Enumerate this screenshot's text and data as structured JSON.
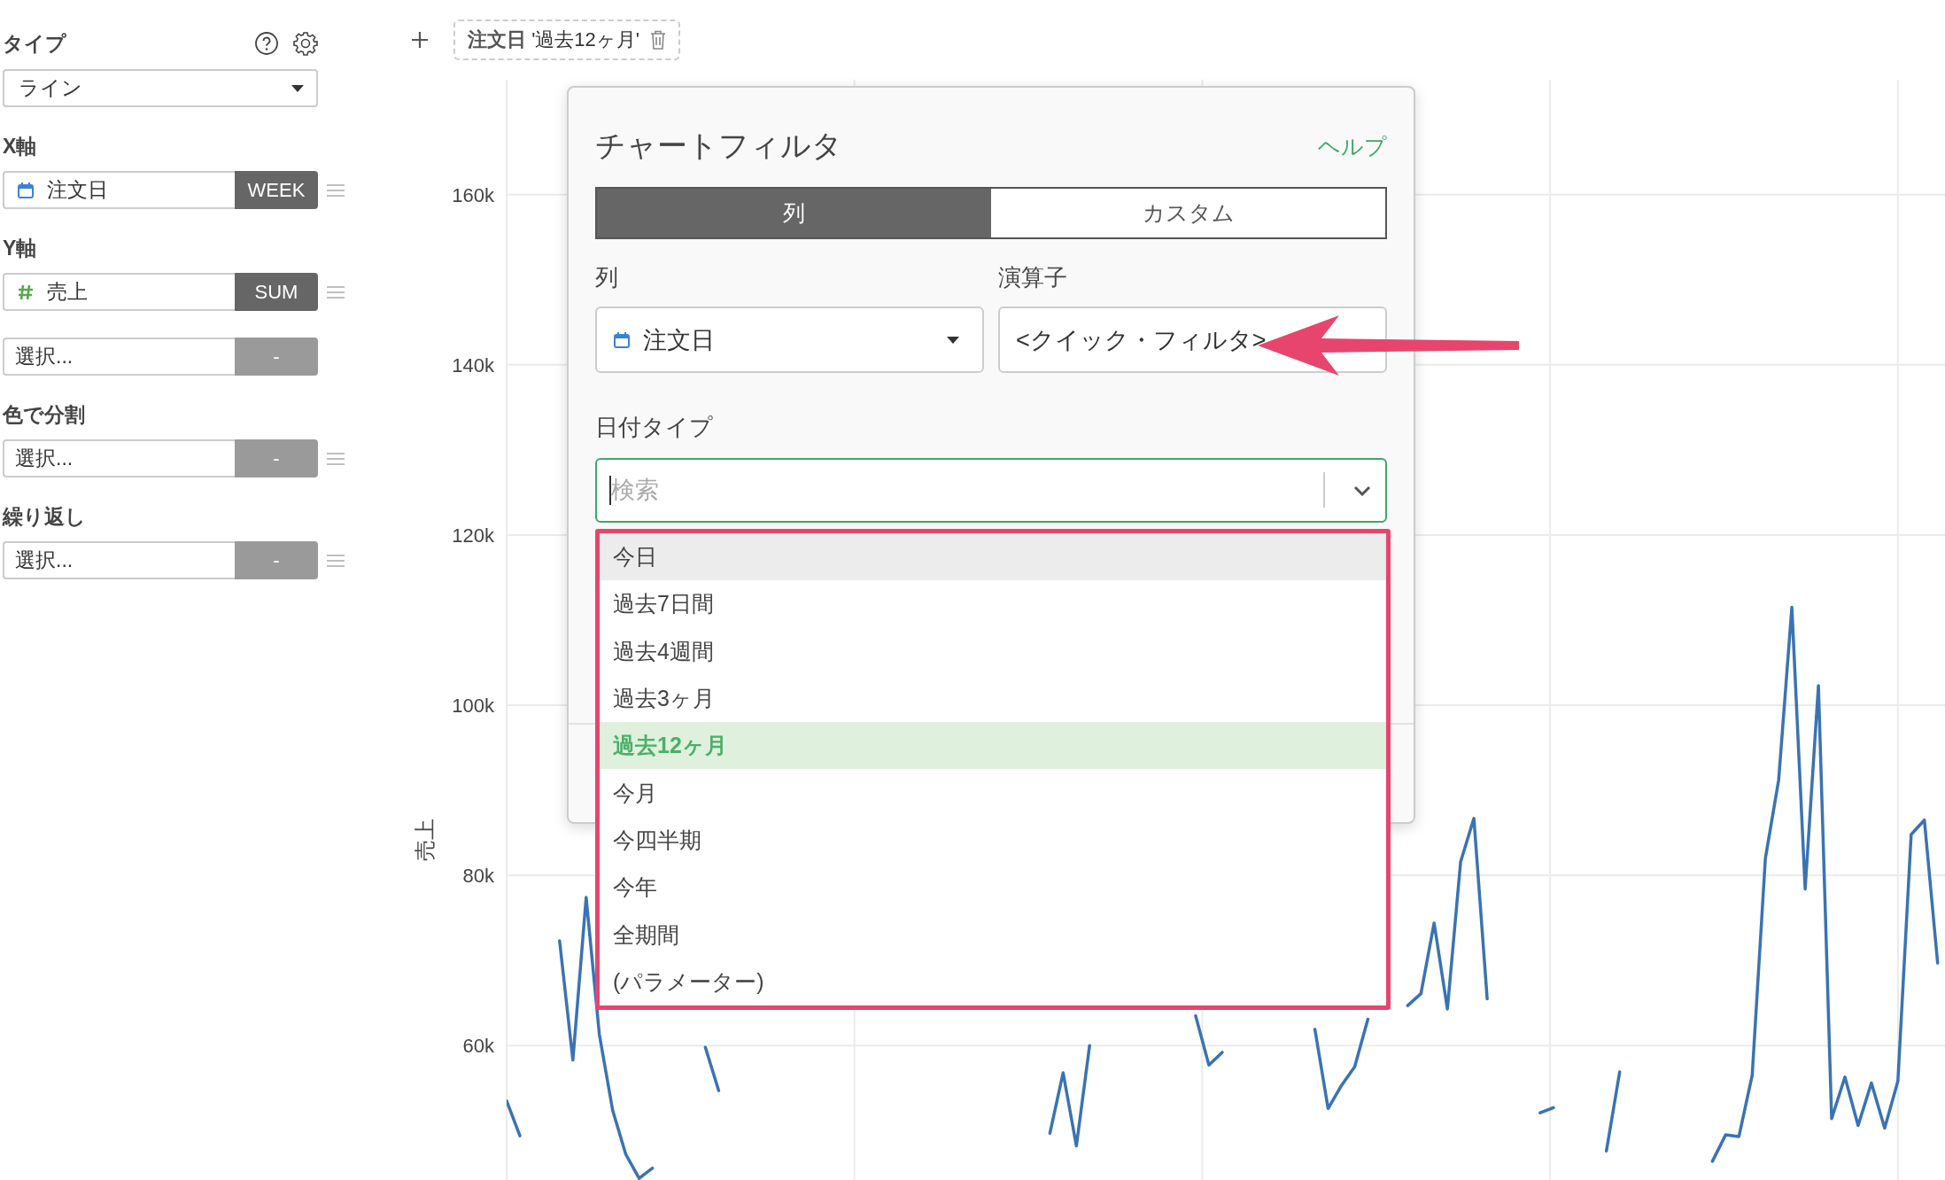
{
  "sidebar": {
    "title": "タイプ",
    "chart_type": "ライン",
    "sections": [
      {
        "label": "X軸",
        "rows": [
          {
            "kind": "date",
            "field": "注文日",
            "tag": "WEEK",
            "handle": true
          }
        ]
      },
      {
        "label": "Y軸",
        "rows": [
          {
            "kind": "number",
            "field": "売上",
            "tag": "SUM",
            "handle": true
          },
          {
            "kind": "empty",
            "field": "選択...",
            "tag": "-",
            "handle": false
          }
        ]
      },
      {
        "label": "色で分割",
        "rows": [
          {
            "kind": "empty",
            "field": "選択...",
            "tag": "-",
            "handle": true
          }
        ]
      },
      {
        "label": "繰り返し",
        "rows": [
          {
            "kind": "empty",
            "field": "選択...",
            "tag": "-",
            "handle": true
          }
        ]
      }
    ]
  },
  "filter_bar": {
    "filters": [
      {
        "column": "注文日",
        "value": "'過去12ヶ月'"
      }
    ]
  },
  "chart": {
    "chart_data": {
      "type": "line",
      "ylabel": "売上",
      "grid": true,
      "ylim": [
        44.2,
        173.5
      ],
      "yticks": [
        {
          "value": 60,
          "label": "60k"
        },
        {
          "value": 80,
          "label": "80k"
        },
        {
          "value": 100,
          "label": "100k"
        },
        {
          "value": 120,
          "label": "120k"
        },
        {
          "value": 140,
          "label": "140k"
        },
        {
          "value": 160,
          "label": "160k"
        }
      ],
      "series": [
        {
          "color": "#3a73b3",
          "values": [
            53.5,
            49.4,
            null,
            null,
            72.3,
            58.3,
            77.4,
            61.3,
            52.4,
            47.2,
            44.4,
            45.6,
            null,
            null,
            null,
            59.8,
            54.7,
            null,
            null,
            null,
            null,
            null,
            null,
            null,
            null,
            null,
            null,
            null,
            null,
            null,
            null,
            null,
            null,
            null,
            null,
            null,
            null,
            null,
            null,
            null,
            null,
            49.7,
            56.8,
            48.2,
            60,
            null,
            null,
            null,
            null,
            null,
            null,
            null,
            63.5,
            57.7,
            59.2,
            null,
            null,
            null,
            null,
            null,
            null,
            61.9,
            52.6,
            55.3,
            57.5,
            63.1,
            null,
            null,
            64.7,
            66.1,
            74.4,
            64.3,
            81.6,
            86.7,
            65.5,
            null,
            null,
            null,
            52.1,
            52.7,
            null,
            null,
            null,
            47.6,
            56.9,
            null,
            null,
            null,
            null,
            null,
            null,
            46.4,
            49.5,
            49.3,
            56.5,
            82,
            91.2,
            111.5,
            78.4,
            102.3,
            51.4,
            56.3,
            50.6,
            55.6,
            50.3,
            55.8,
            84.8,
            86.5,
            69.7
          ]
        }
      ]
    }
  },
  "dialog": {
    "title": "チャートフィルタ",
    "help": "ヘルプ",
    "tabs": [
      {
        "label": "列",
        "selected": true
      },
      {
        "label": "カスタム",
        "selected": false
      }
    ],
    "column_label": "列",
    "column_value": "注文日",
    "operator_label": "演算子",
    "operator_value": "<クイック・フィルタ>",
    "date_type_label": "日付タイプ",
    "search": {
      "placeholder": "検索"
    },
    "options": [
      {
        "label": "今日",
        "selected": false,
        "hovered": true
      },
      {
        "label": "過去7日間",
        "selected": false,
        "hovered": false
      },
      {
        "label": "過去4週間",
        "selected": false,
        "hovered": false
      },
      {
        "label": "過去3ヶ月",
        "selected": false,
        "hovered": false
      },
      {
        "label": "過去12ヶ月",
        "selected": true,
        "hovered": false
      },
      {
        "label": "今月",
        "selected": false,
        "hovered": false
      },
      {
        "label": "今四半期",
        "selected": false,
        "hovered": false
      },
      {
        "label": "今年",
        "selected": false,
        "hovered": false
      },
      {
        "label": "全期間",
        "selected": false,
        "hovered": false
      },
      {
        "label": "(パラメーター)",
        "selected": false,
        "hovered": false
      }
    ]
  }
}
